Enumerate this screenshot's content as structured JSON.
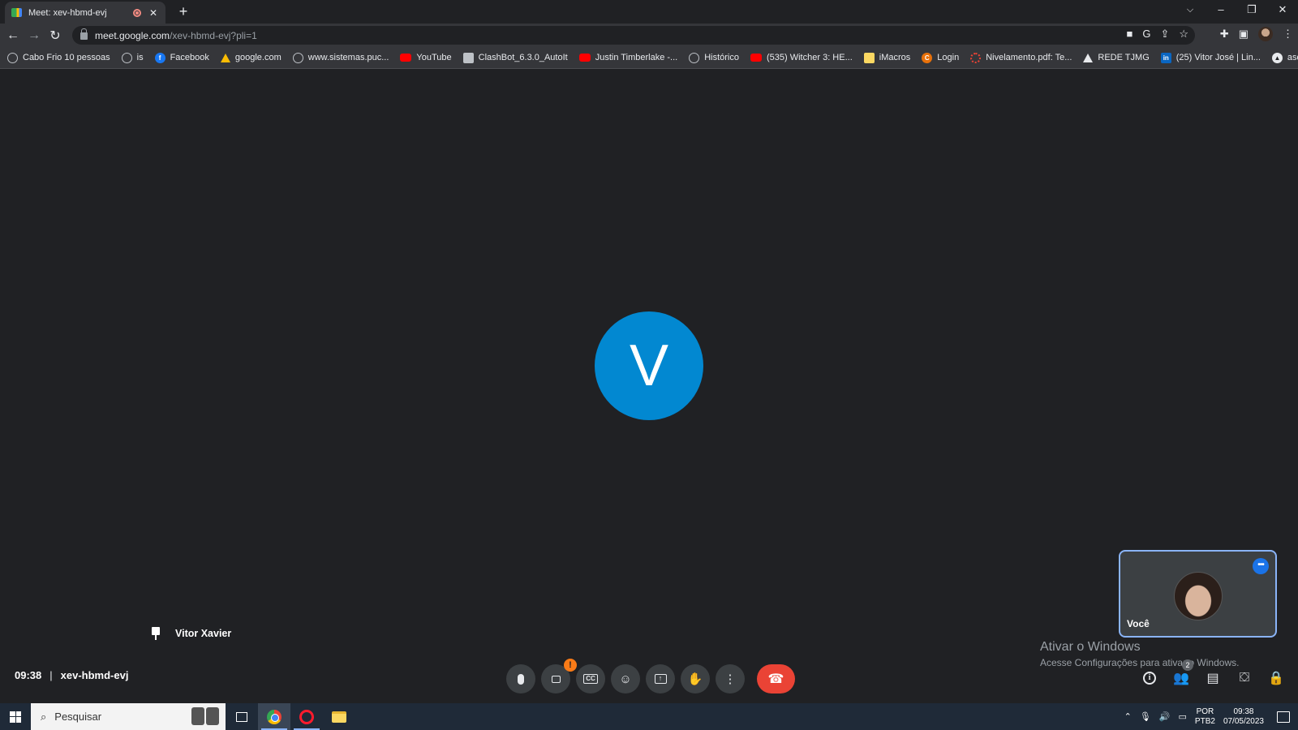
{
  "browser": {
    "tab": {
      "title": "Meet: xev-hbmd-evj"
    },
    "new_tab_label": "+",
    "url": {
      "host": "meet.google.com",
      "path": "/xev-hbmd-evj?pli=1"
    },
    "window_controls": {
      "tablist": "⌵",
      "minimize": "–",
      "restore": "❐",
      "close": "✕"
    },
    "bookmarks": [
      {
        "label": "Cabo Frio 10 pessoas",
        "icon": "globe"
      },
      {
        "label": "is",
        "icon": "globe"
      },
      {
        "label": "Facebook",
        "icon": "fb"
      },
      {
        "label": "google.com",
        "icon": "gads"
      },
      {
        "label": "www.sistemas.puc...",
        "icon": "globe"
      },
      {
        "label": "YouTube",
        "icon": "yt"
      },
      {
        "label": "ClashBot_6.3.0_AutoIt",
        "icon": "clash"
      },
      {
        "label": "Justin Timberlake -...",
        "icon": "yt"
      },
      {
        "label": "Histórico",
        "icon": "hist"
      },
      {
        "label": "(535) Witcher 3: HE...",
        "icon": "yt"
      },
      {
        "label": "iMacros",
        "icon": "folder"
      },
      {
        "label": "Login",
        "icon": "login"
      },
      {
        "label": "Nivelamento.pdf: Te...",
        "icon": "niv"
      },
      {
        "label": "REDE TJMG",
        "icon": "tri"
      },
      {
        "label": "(25) Vitor José | Lin...",
        "icon": "li"
      },
      {
        "label": "asdad",
        "icon": "asdad"
      }
    ]
  },
  "meet": {
    "main_avatar_letter": "V",
    "pinned_participant": "Vitor Xavier",
    "self_tile_label": "Você",
    "time": "09:38",
    "meeting_code": "xev-hbmd-evj",
    "people_count": "2",
    "camera_warning": "!",
    "watermark": {
      "line1": "Ativar o Windows",
      "line2": "Acesse Configurações para ativar o Windows."
    }
  },
  "taskbar": {
    "search_placeholder": "Pesquisar",
    "lang_line1": "POR",
    "lang_line2": "PTB2",
    "clock_time": "09:38",
    "clock_date": "07/05/2023"
  }
}
